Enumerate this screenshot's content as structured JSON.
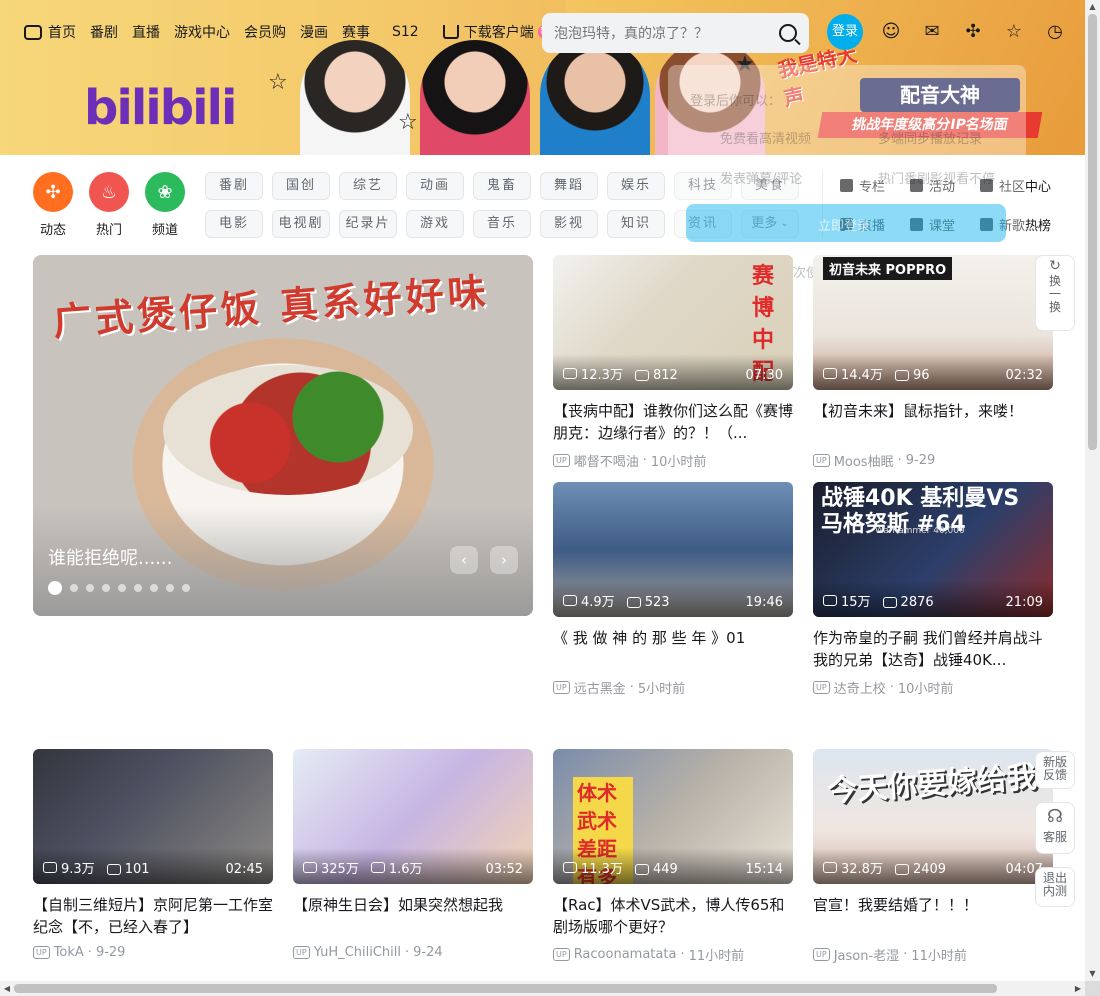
{
  "nav": {
    "items": [
      "首页",
      "番剧",
      "直播",
      "游戏中心",
      "会员购",
      "漫画",
      "赛事",
      "S12"
    ],
    "download": "下载客户端",
    "new_badge": "新"
  },
  "search": {
    "placeholder": "泡泡玛特，真的凉了？？"
  },
  "login": "登录",
  "logo_text": "bilibili",
  "banner": {
    "promo_logo": "我是特大声",
    "promo_title": "配音大神",
    "promo_sub": "挑战年度级高分IP名场面"
  },
  "quick": [
    {
      "label": "动态",
      "color": "#ff6f1f",
      "icon": "dynamic-icon"
    },
    {
      "label": "热门",
      "color": "#f0564f",
      "icon": "fire-icon"
    },
    {
      "label": "频道",
      "color": "#2bba5c",
      "icon": "channel-icon"
    }
  ],
  "categories": [
    "番剧",
    "国创",
    "综艺",
    "动画",
    "鬼畜",
    "舞蹈",
    "娱乐",
    "科技",
    "美食",
    "电影",
    "电视剧",
    "纪录片",
    "游戏",
    "音乐",
    "影视",
    "知识",
    "资讯",
    "更多"
  ],
  "side_links": [
    "专栏",
    "活动",
    "社区中心",
    "直播",
    "课堂",
    "新歌热榜"
  ],
  "overlay": {
    "line1": "登录后你可以：",
    "line2": "免费看高清视频",
    "line3": "多端同步播放记录",
    "line4": "发表弹幕/评论",
    "line5": "热门番剧影视看不停",
    "button": "立即登录",
    "footer": "首次使用？点我注册"
  },
  "carousel": {
    "art_title": "广式煲仔饭 真系好好味",
    "caption": "谁能拒绝呢......",
    "dot_count": 9
  },
  "videos": [
    {
      "views": "12.3万",
      "danmaku": "812",
      "duration": "07:30",
      "title": "【丧病中配】谁教你们这么配《赛博朋克：边缘行者》的？！（...",
      "author": "嘟督不喝油",
      "time": "10小时前",
      "thumb_text": "赛博中配"
    },
    {
      "views": "14.4万",
      "danmaku": "96",
      "duration": "02:32",
      "title": "【初音未来】鼠标指针，来喽！",
      "author": "Moos柚眠",
      "time": "9-29",
      "thumb_text": "初音未来 POPPRO"
    },
    {
      "views": "4.9万",
      "danmaku": "523",
      "duration": "19:46",
      "title": "《 我 做 神 的 那 些 年 》01",
      "author": "远古黑金",
      "time": "5小时前",
      "thumb_text": ""
    },
    {
      "views": "15万",
      "danmaku": "2876",
      "duration": "21:09",
      "title": "作为帝皇的子嗣 我们曾经并肩战斗 我的兄弟【达奇】战锤40K...",
      "author": "达奇上校",
      "time": "10小时前",
      "thumb_text": "战锤40K 基利曼VS马格努斯 #64",
      "thumb_sub": "Warhammer 40,000"
    },
    {
      "views": "9.3万",
      "danmaku": "101",
      "duration": "02:45",
      "title": "【自制三维短片】京阿尼第一工作室纪念【不，已经入春了】",
      "author": "TokA",
      "time": "9-29",
      "thumb_text": ""
    },
    {
      "views": "325万",
      "danmaku": "1.6万",
      "duration": "03:52",
      "title": "【原神生日会】如果突然想起我",
      "author": "YuH_ChiliChill",
      "time": "9-24",
      "thumb_text": ""
    },
    {
      "views": "11.3万",
      "danmaku": "449",
      "duration": "15:14",
      "title": "【Rac】体术VS武术，博人传65和剧场版哪个更好？",
      "author": "Racoonamatata",
      "time": "11小时前",
      "thumb_text": "体术 武术 差距有多大？"
    },
    {
      "views": "32.8万",
      "danmaku": "2409",
      "duration": "04:07",
      "title": "官宣！我要结婚了！！！",
      "author": "Jason-老湿",
      "time": "11小时前",
      "thumb_text": "今天你要嫁给我"
    }
  ],
  "float": {
    "refresh": "换一换",
    "feedback": "新版反馈",
    "service": "客服",
    "exit": "退出内测"
  },
  "colors": {
    "accent": "#00aeec",
    "brand_pink": "#ff6699"
  }
}
